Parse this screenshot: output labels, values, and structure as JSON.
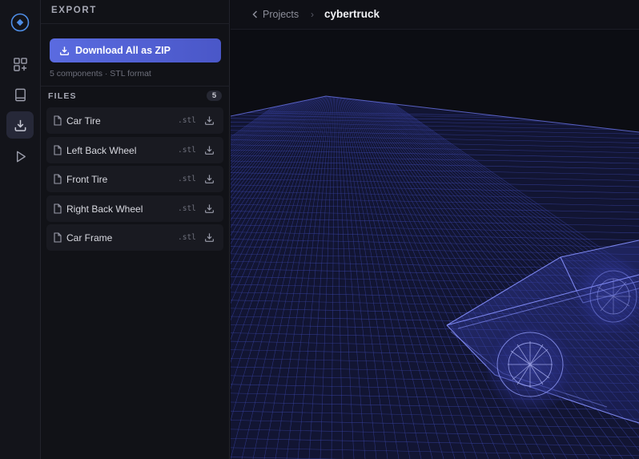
{
  "rail": {
    "items": [
      {
        "name": "components-icon"
      },
      {
        "name": "docs-icon"
      },
      {
        "name": "export-icon",
        "active": true
      },
      {
        "name": "play-icon"
      }
    ]
  },
  "panel": {
    "title": "EXPORT",
    "download_all_label": "Download All as ZIP",
    "subtext": "5 components · STL format",
    "files_label": "FILES",
    "files_count": "5",
    "files": [
      {
        "name": "Car Tire",
        "ext": ".stl"
      },
      {
        "name": "Left Back Wheel",
        "ext": ".stl"
      },
      {
        "name": "Front Tire",
        "ext": ".stl"
      },
      {
        "name": "Right Back Wheel",
        "ext": ".stl"
      },
      {
        "name": "Car Frame",
        "ext": ".stl"
      }
    ]
  },
  "header": {
    "breadcrumb_parent": "Projects",
    "breadcrumb_separator": "›",
    "breadcrumb_current": "cybertruck"
  },
  "colors": {
    "accent": "#5a6be0",
    "wireframe": "#5b66e6",
    "background": "#0c0d13"
  }
}
